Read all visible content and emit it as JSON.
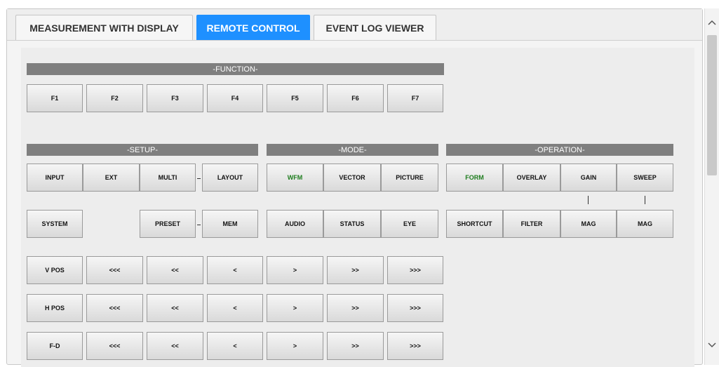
{
  "tabs": [
    {
      "label": "MEASUREMENT WITH DISPLAY"
    },
    {
      "label": "REMOTE CONTROL"
    },
    {
      "label": "EVENT LOG VIEWER"
    }
  ],
  "sections": {
    "function": "-FUNCTION-",
    "setup": "-SETUP-",
    "mode": "-MODE-",
    "operation": "-OPERATION-"
  },
  "function_buttons": [
    "F1",
    "F2",
    "F3",
    "F4",
    "F5",
    "F6",
    "F7"
  ],
  "setup": {
    "input": "INPUT",
    "ext": "EXT",
    "multi": "MULTI",
    "layout": "LAYOUT",
    "system": "SYSTEM",
    "preset": "PRESET",
    "mem": "MEM"
  },
  "mode": {
    "wfm": "WFM",
    "vector": "VECTOR",
    "picture": "PICTURE",
    "audio": "AUDIO",
    "status": "STATUS",
    "eye": "EYE"
  },
  "operation": {
    "form": "FORM",
    "overlay": "OVERLAY",
    "gain": "GAIN",
    "sweep": "SWEEP",
    "shortcut": "SHORTCUT",
    "filter": "FILTER",
    "mag_gain": "MAG",
    "mag_sweep": "MAG"
  },
  "position_rows": [
    {
      "label": "V POS",
      "steps": [
        "<<<",
        "<<",
        "<",
        ">",
        ">>",
        ">>>"
      ]
    },
    {
      "label": "H POS",
      "steps": [
        "<<<",
        "<<",
        "<",
        ">",
        ">>",
        ">>>"
      ]
    },
    {
      "label": "F-D",
      "steps": [
        "<<<",
        "<<",
        "<",
        ">",
        ">>",
        ">>>"
      ]
    }
  ],
  "colors": {
    "active_tab": "#1e90ff",
    "highlight_text": "#1e7d1e",
    "section_header": "#7f7f7f"
  },
  "scrollbar": {
    "up_icon": "chevron-up-icon",
    "down_icon": "chevron-down-icon"
  }
}
